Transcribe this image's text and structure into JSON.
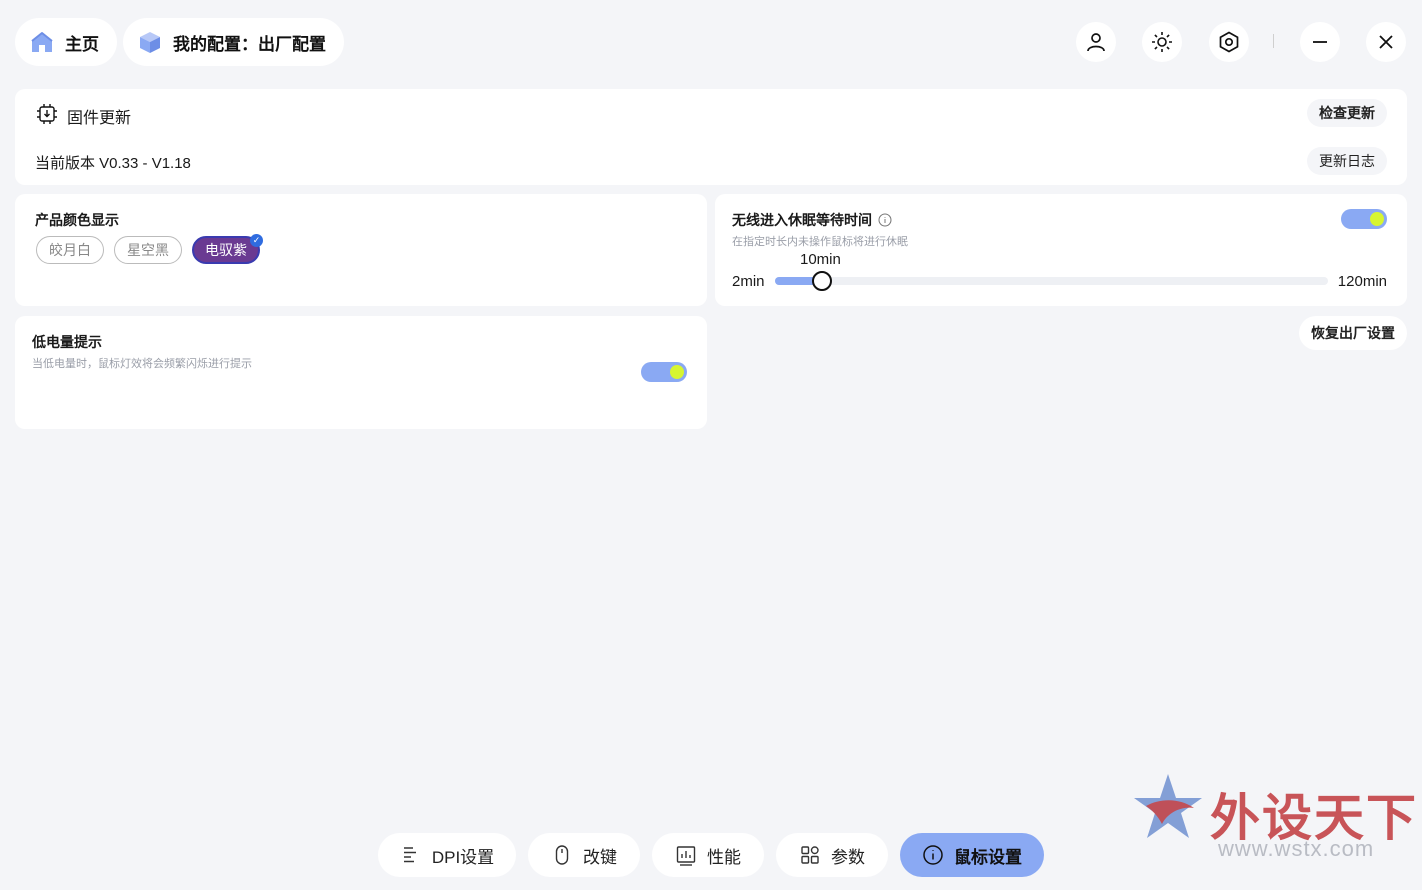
{
  "nav": {
    "home_label": "主页",
    "config_label": "我的配置：出厂配置"
  },
  "top_icons": [
    "user-icon",
    "brightness-icon",
    "settings-hex-icon",
    "minimize-icon",
    "close-icon"
  ],
  "firmware": {
    "title": "固件更新",
    "version": "当前版本 V0.33 - V1.18",
    "check_update": "检查更新",
    "changelog": "更新日志"
  },
  "color_display": {
    "title": "产品颜色显示",
    "options": [
      "皎月白",
      "星空黑",
      "电驭紫"
    ],
    "selected": "电驭紫"
  },
  "sleep": {
    "title": "无线进入休眠等待时间",
    "subtitle": "在指定时长内未操作鼠标将进行休眠",
    "enabled": true,
    "min_label": "2min",
    "max_label": "120min",
    "value_label": "10min",
    "min": 2,
    "max": 120,
    "value": 10
  },
  "low_battery": {
    "title": "低电量提示",
    "subtitle": "当低电量时，鼠标灯效将会频繁闪烁进行提示",
    "enabled": true
  },
  "reset_label": "恢复出厂设置",
  "tabs": [
    {
      "label": "DPI设置",
      "icon": "dpi-icon"
    },
    {
      "label": "改键",
      "icon": "mouse-icon"
    },
    {
      "label": "性能",
      "icon": "performance-icon"
    },
    {
      "label": "参数",
      "icon": "params-grid-icon"
    },
    {
      "label": "鼠标设置",
      "icon": "info-icon",
      "active": true
    }
  ],
  "watermark": {
    "text": "外设天下",
    "url": "www.wstx.com"
  },
  "colors": {
    "accent": "#8aa9f3",
    "toggle_knob": "#d7f531",
    "purple": "#6a3a92"
  }
}
